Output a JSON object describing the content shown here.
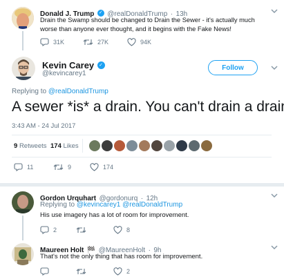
{
  "top_tweet": {
    "name": "Donald J. Trump",
    "handle": "@realDonaldTrump",
    "time": "13h",
    "text_line1": "Drain the Swamp should be changed to Drain the Sewer - it's actually much",
    "text_line2": "worse than anyone ever thought, and it begins with the Fake News!",
    "replies": "31K",
    "retweets": "27K",
    "likes": "94K"
  },
  "main_tweet": {
    "name": "Kevin Carey",
    "handle": "@kevincarey1",
    "follow_label": "Follow",
    "replying_prefix": "Replying to",
    "replying_to": "@realDonaldTrump",
    "text": "A sewer *is* a drain. You can't drain a drain.",
    "timestamp": "3:43 AM - 24 Jul 2017",
    "retweets_count": "9",
    "retweets_label": "Retweets",
    "likes_count": "174",
    "likes_label": "Likes",
    "replies": "11",
    "retweets": "9",
    "likes": "174"
  },
  "reply1": {
    "name": "Gordon Urquhart",
    "handle": "@gordonurq",
    "time": "12h",
    "replying_prefix": "Replying to",
    "replying_to": "@kevincarey1 @realDonaldTrump",
    "text": "His use imagery has a lot of room for improvement.",
    "replies": "2",
    "retweets": "",
    "likes": "8"
  },
  "reply2": {
    "name": "Maureen Holt",
    "handle": "@MaureenHolt",
    "time": "9h",
    "flag_glyph": "🏁",
    "text": "That's not the only thing that has room for improvement.",
    "replies": "",
    "retweets": "",
    "likes": "2"
  },
  "colors": {
    "accent": "#1da1f2",
    "muted": "#657786",
    "divider": "#e6ecf0"
  }
}
